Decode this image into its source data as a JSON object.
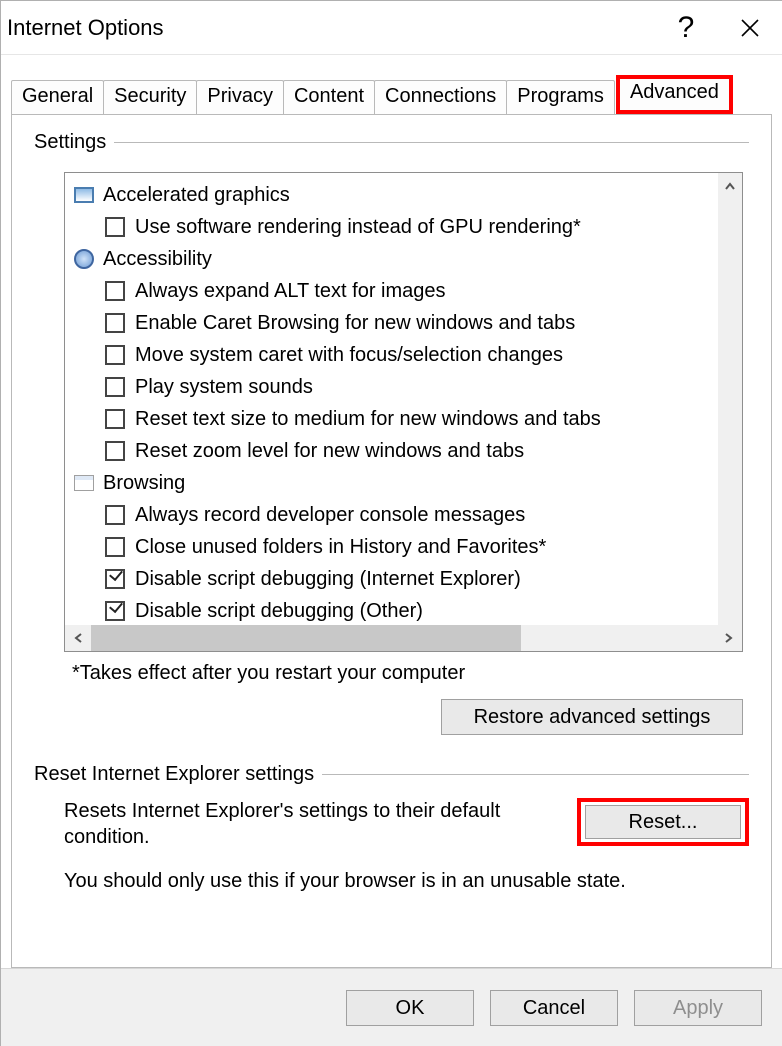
{
  "window": {
    "title": "Internet Options"
  },
  "tabs": [
    "General",
    "Security",
    "Privacy",
    "Content",
    "Connections",
    "Programs",
    "Advanced"
  ],
  "settings_label": "Settings",
  "categories": [
    {
      "icon": "monitor",
      "name": "Accelerated graphics",
      "options": [
        {
          "label": "Use software rendering instead of GPU rendering*",
          "checked": false
        }
      ]
    },
    {
      "icon": "access",
      "name": "Accessibility",
      "options": [
        {
          "label": "Always expand ALT text for images",
          "checked": false
        },
        {
          "label": "Enable Caret Browsing for new windows and tabs",
          "checked": false
        },
        {
          "label": "Move system caret with focus/selection changes",
          "checked": false
        },
        {
          "label": "Play system sounds",
          "checked": false
        },
        {
          "label": "Reset text size to medium for new windows and tabs",
          "checked": false
        },
        {
          "label": "Reset zoom level for new windows and tabs",
          "checked": false
        }
      ]
    },
    {
      "icon": "browse",
      "name": "Browsing",
      "options": [
        {
          "label": "Always record developer console messages",
          "checked": false
        },
        {
          "label": "Close unused folders in History and Favorites*",
          "checked": false
        },
        {
          "label": "Disable script debugging (Internet Explorer)",
          "checked": true
        },
        {
          "label": "Disable script debugging (Other)",
          "checked": true
        }
      ]
    }
  ],
  "restart_note": "*Takes effect after you restart your computer",
  "restore_btn": "Restore advanced settings",
  "reset_group_label": "Reset Internet Explorer settings",
  "reset_desc": "Resets Internet Explorer's settings to their default condition.",
  "reset_btn": "Reset...",
  "reset_warn": "You should only use this if your browser is in an unusable state.",
  "buttons": {
    "ok": "OK",
    "cancel": "Cancel",
    "apply": "Apply"
  }
}
